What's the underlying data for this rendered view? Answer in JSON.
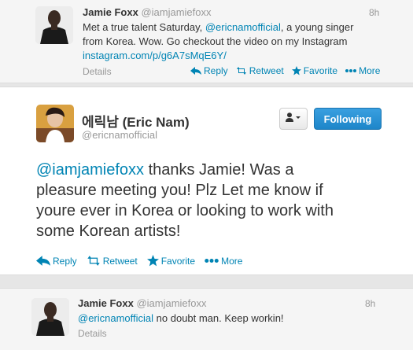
{
  "tweet1": {
    "name": "Jamie Foxx",
    "handle": "@iamjamiefoxx",
    "time": "8h",
    "text_line1_a": "Met a true talent Saturday, ",
    "mention": "@ericnamofficial",
    "text_line1_b": ", a young singer",
    "text_line2": "from Korea. Wow. Go checkout the video on my Instagram",
    "link": "instagram.com/p/g6A7sMqE6Y/",
    "details": "Details",
    "actions": {
      "reply": "Reply",
      "retweet": "Retweet",
      "favorite": "Favorite",
      "more": "More"
    }
  },
  "tweet2": {
    "name": "에릭남 (Eric Nam)",
    "handle": "@ericnamofficial",
    "follow_label": "Following",
    "mention": "@iamjamiefoxx",
    "text_1": " thanks Jamie! Was a",
    "text_2": "pleasure meeting you! Plz Let me know if",
    "text_3": "youre ever in Korea or looking to work with",
    "text_4": "some Korean artists!",
    "actions": {
      "reply": "Reply",
      "retweet": "Retweet",
      "favorite": "Favorite",
      "more": "More"
    }
  },
  "tweet3": {
    "name": "Jamie Foxx",
    "handle": "@iamjamiefoxx",
    "time": "8h",
    "mention": "@ericnamofficial",
    "text": " no doubt man. Keep workin!",
    "details": "Details"
  },
  "colors": {
    "link": "#0084b4",
    "follow_button": "#1d86c9",
    "muted": "#999999"
  }
}
